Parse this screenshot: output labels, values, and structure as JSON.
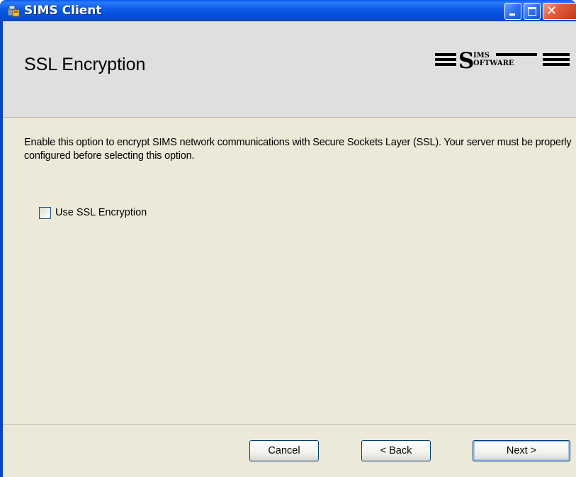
{
  "window": {
    "title": "SIMS Client"
  },
  "banner": {
    "title": "SSL Encryption",
    "logo": {
      "letter": "S",
      "top_text": "IMS",
      "bottom_text": "OFTWARE"
    }
  },
  "content": {
    "description": "Enable this option to encrypt SIMS network communications with Secure Sockets Layer (SSL). Your server must be properly configured before selecting this option.",
    "checkbox": {
      "label": "Use SSL Encryption",
      "checked": false
    }
  },
  "buttons": {
    "cancel": "Cancel",
    "back": "< Back",
    "next": "Next >"
  },
  "colors": {
    "titlebar": "#0a58e6",
    "dialog_bg": "#ece9d8",
    "banner_bg": "#dfdfdf",
    "close_button": "#e2583a"
  }
}
